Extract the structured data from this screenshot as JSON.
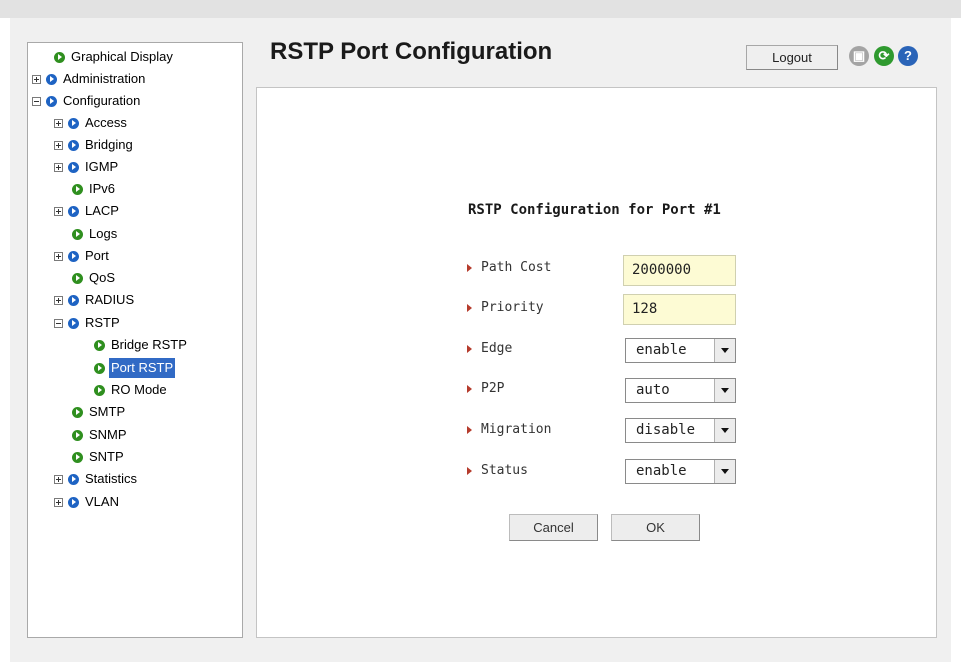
{
  "header": {
    "title": "RSTP Port Configuration",
    "logout_label": "Logout",
    "icons": [
      "save-icon",
      "refresh-icon",
      "help-icon"
    ]
  },
  "nav": {
    "items": [
      {
        "label": "Graphical Display",
        "toggle": "none",
        "bullet": "green",
        "selected": false
      },
      {
        "label": "Administration",
        "toggle": "plus",
        "bullet": "blue",
        "selected": false
      },
      {
        "label": "Configuration",
        "toggle": "minus",
        "bullet": "blue",
        "selected": false
      },
      {
        "label": "Access",
        "toggle": "plus",
        "bullet": "blue",
        "selected": false
      },
      {
        "label": "Bridging",
        "toggle": "plus",
        "bullet": "blue",
        "selected": false
      },
      {
        "label": "IGMP",
        "toggle": "plus",
        "bullet": "blue",
        "selected": false
      },
      {
        "label": "IPv6",
        "toggle": "none",
        "bullet": "green",
        "selected": false
      },
      {
        "label": "LACP",
        "toggle": "plus",
        "bullet": "blue",
        "selected": false
      },
      {
        "label": "Logs",
        "toggle": "none",
        "bullet": "green",
        "selected": false
      },
      {
        "label": "Port",
        "toggle": "plus",
        "bullet": "blue",
        "selected": false
      },
      {
        "label": "QoS",
        "toggle": "none",
        "bullet": "green",
        "selected": false
      },
      {
        "label": "RADIUS",
        "toggle": "plus",
        "bullet": "blue",
        "selected": false
      },
      {
        "label": "RSTP",
        "toggle": "minus",
        "bullet": "blue",
        "selected": false
      },
      {
        "label": "Bridge RSTP",
        "toggle": "none",
        "bullet": "green",
        "selected": false
      },
      {
        "label": "Port RSTP",
        "toggle": "none",
        "bullet": "green",
        "selected": true
      },
      {
        "label": "RO Mode",
        "toggle": "none",
        "bullet": "green",
        "selected": false
      },
      {
        "label": "SMTP",
        "toggle": "none",
        "bullet": "green",
        "selected": false
      },
      {
        "label": "SNMP",
        "toggle": "none",
        "bullet": "green",
        "selected": false
      },
      {
        "label": "SNTP",
        "toggle": "none",
        "bullet": "green",
        "selected": false
      },
      {
        "label": "Statistics",
        "toggle": "plus",
        "bullet": "blue",
        "selected": false
      },
      {
        "label": "VLAN",
        "toggle": "plus",
        "bullet": "blue",
        "selected": false
      }
    ]
  },
  "form": {
    "title": "RSTP Configuration for Port #1",
    "fields": [
      {
        "label": "Path Cost",
        "type": "text",
        "value": "2000000"
      },
      {
        "label": "Priority",
        "type": "text",
        "value": "128"
      },
      {
        "label": "Edge",
        "type": "select",
        "value": "enable"
      },
      {
        "label": "P2P",
        "type": "select",
        "value": "auto"
      },
      {
        "label": "Migration",
        "type": "select",
        "value": "disable"
      },
      {
        "label": "Status",
        "type": "select",
        "value": "enable"
      }
    ],
    "cancel_label": "Cancel",
    "ok_label": "OK"
  },
  "colors": {
    "selected_bg": "#316ac5",
    "input_bg": "#fdfbd4",
    "bullet_blue": "#1e63c3",
    "bullet_green": "#2f8f1f",
    "label_marker": "#b53b2c"
  }
}
